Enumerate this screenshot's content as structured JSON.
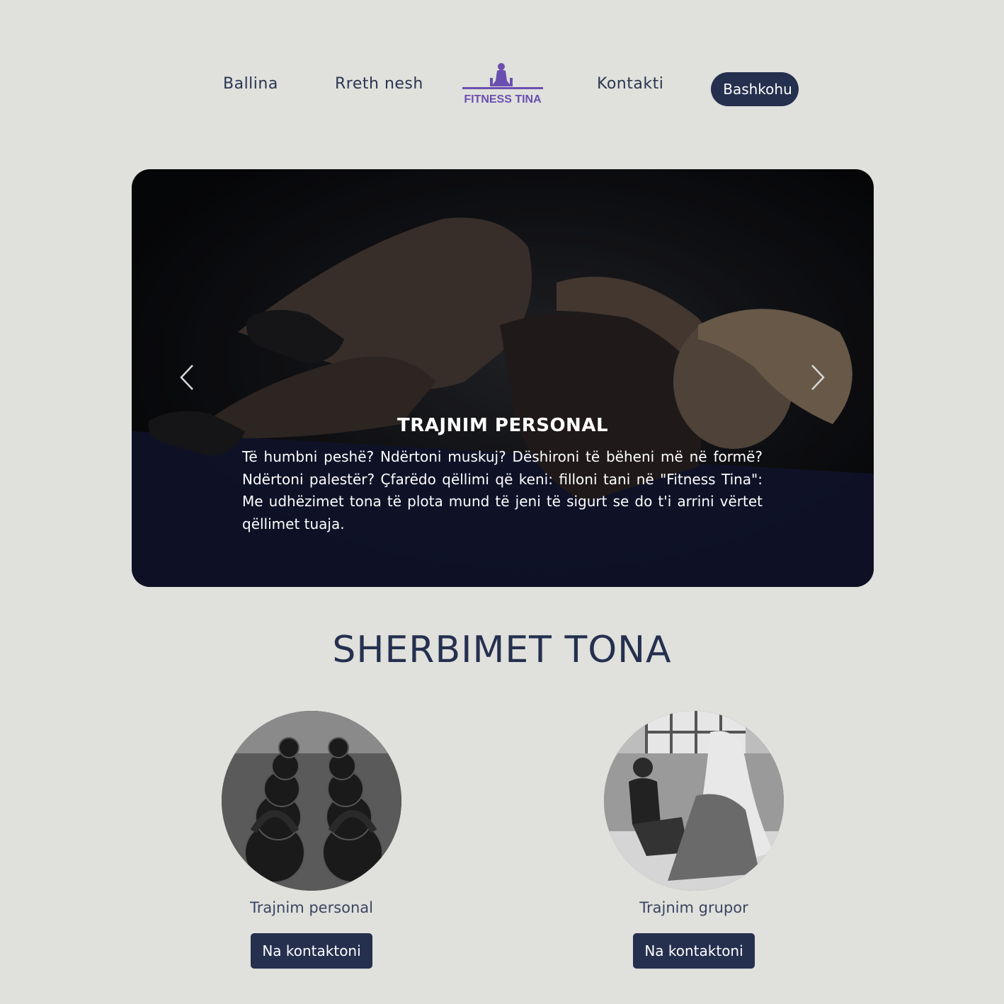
{
  "nav": {
    "links": [
      "Ballina",
      "Rreth nesh",
      "Kontakti"
    ],
    "logo_text": "FITNESS TINA",
    "join_label": "Bashkohu"
  },
  "hero": {
    "title": "TRAJNIM PERSONAL",
    "text": "Të humbni peshë? Ndërtoni muskuj? Dëshironi të bëheni më në formë? Ndërtoni palestër? Çfarëdo qëllimi që keni: filloni tani në \"Fitness Tina\": Me udhëzimet tona të plota mund të jeni të sigurt se do t'i arrini vërtet qëllimet tuaja."
  },
  "services": {
    "title": "SHERBIMET TONA",
    "items": [
      {
        "label": "Trajnim personal",
        "button": "Na kontaktoni"
      },
      {
        "label": "Trajnim grupor",
        "button": "Na kontaktoni"
      }
    ]
  },
  "colors": {
    "background": "#e0e0dc",
    "primary": "#25304f",
    "logo": "#6a4fb0"
  }
}
